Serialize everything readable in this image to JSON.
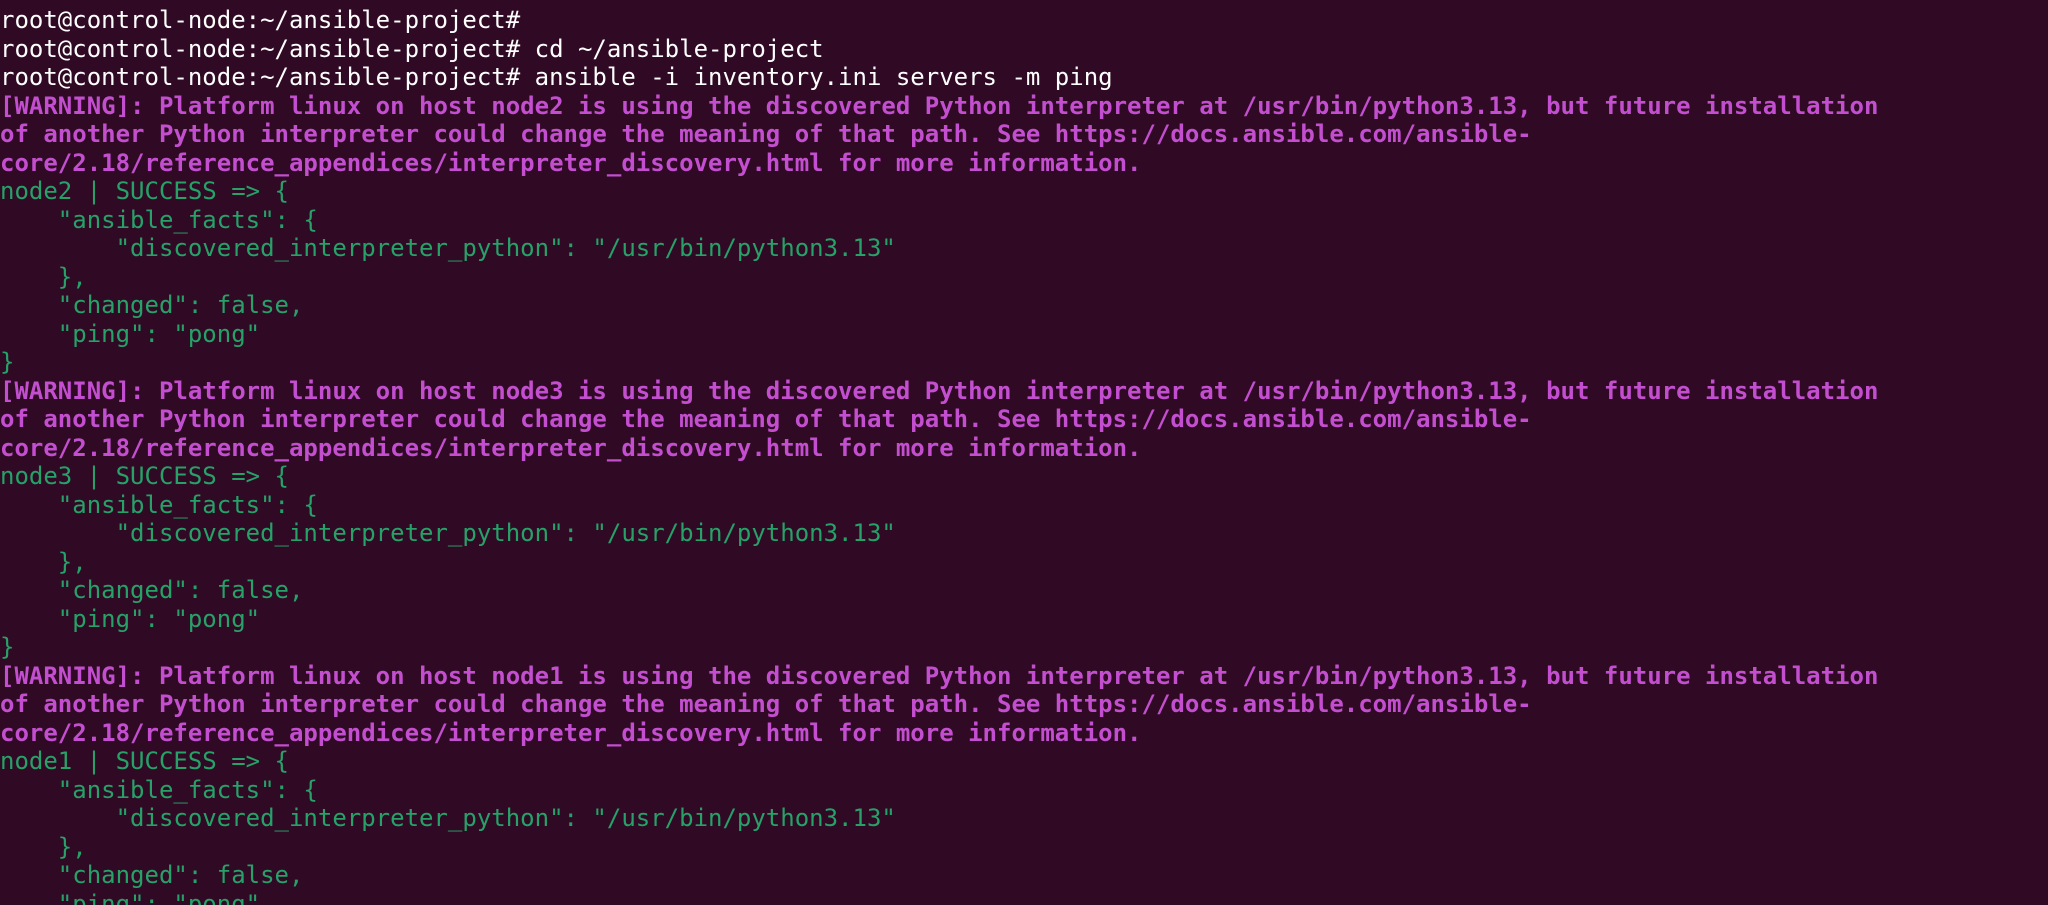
{
  "theme": {
    "background": "#300a24",
    "prompt_color": "#ffffff",
    "warning_color": "#c34fd0",
    "success_color": "#26a269"
  },
  "terminal": {
    "lines": [
      {
        "kind": "prompt",
        "text": "root@control-node:~/ansible-project#"
      },
      {
        "kind": "prompt",
        "text": "root@control-node:~/ansible-project# cd ~/ansible-project"
      },
      {
        "kind": "prompt",
        "text": "root@control-node:~/ansible-project# ansible -i inventory.ini servers -m ping"
      },
      {
        "kind": "warning",
        "text": "[WARNING]: Platform linux on host node2 is using the discovered Python interpreter at /usr/bin/python3.13, but future installation"
      },
      {
        "kind": "warning",
        "text": "of another Python interpreter could change the meaning of that path. See https://docs.ansible.com/ansible-"
      },
      {
        "kind": "warning",
        "text": "core/2.18/reference_appendices/interpreter_discovery.html for more information."
      },
      {
        "kind": "ok",
        "text": "node2 | SUCCESS => {"
      },
      {
        "kind": "ok",
        "text": "    \"ansible_facts\": {"
      },
      {
        "kind": "ok",
        "text": "        \"discovered_interpreter_python\": \"/usr/bin/python3.13\""
      },
      {
        "kind": "ok",
        "text": "    },"
      },
      {
        "kind": "ok",
        "text": "    \"changed\": false,"
      },
      {
        "kind": "ok",
        "text": "    \"ping\": \"pong\""
      },
      {
        "kind": "ok",
        "text": "}"
      },
      {
        "kind": "warning",
        "text": "[WARNING]: Platform linux on host node3 is using the discovered Python interpreter at /usr/bin/python3.13, but future installation"
      },
      {
        "kind": "warning",
        "text": "of another Python interpreter could change the meaning of that path. See https://docs.ansible.com/ansible-"
      },
      {
        "kind": "warning",
        "text": "core/2.18/reference_appendices/interpreter_discovery.html for more information."
      },
      {
        "kind": "ok",
        "text": "node3 | SUCCESS => {"
      },
      {
        "kind": "ok",
        "text": "    \"ansible_facts\": {"
      },
      {
        "kind": "ok",
        "text": "        \"discovered_interpreter_python\": \"/usr/bin/python3.13\""
      },
      {
        "kind": "ok",
        "text": "    },"
      },
      {
        "kind": "ok",
        "text": "    \"changed\": false,"
      },
      {
        "kind": "ok",
        "text": "    \"ping\": \"pong\""
      },
      {
        "kind": "ok",
        "text": "}"
      },
      {
        "kind": "warning",
        "text": "[WARNING]: Platform linux on host node1 is using the discovered Python interpreter at /usr/bin/python3.13, but future installation"
      },
      {
        "kind": "warning",
        "text": "of another Python interpreter could change the meaning of that path. See https://docs.ansible.com/ansible-"
      },
      {
        "kind": "warning",
        "text": "core/2.18/reference_appendices/interpreter_discovery.html for more information."
      },
      {
        "kind": "ok",
        "text": "node1 | SUCCESS => {"
      },
      {
        "kind": "ok",
        "text": "    \"ansible_facts\": {"
      },
      {
        "kind": "ok",
        "text": "        \"discovered_interpreter_python\": \"/usr/bin/python3.13\""
      },
      {
        "kind": "ok",
        "text": "    },"
      },
      {
        "kind": "ok",
        "text": "    \"changed\": false,"
      },
      {
        "kind": "ok",
        "text": "    \"ping\": \"pong\""
      }
    ]
  }
}
